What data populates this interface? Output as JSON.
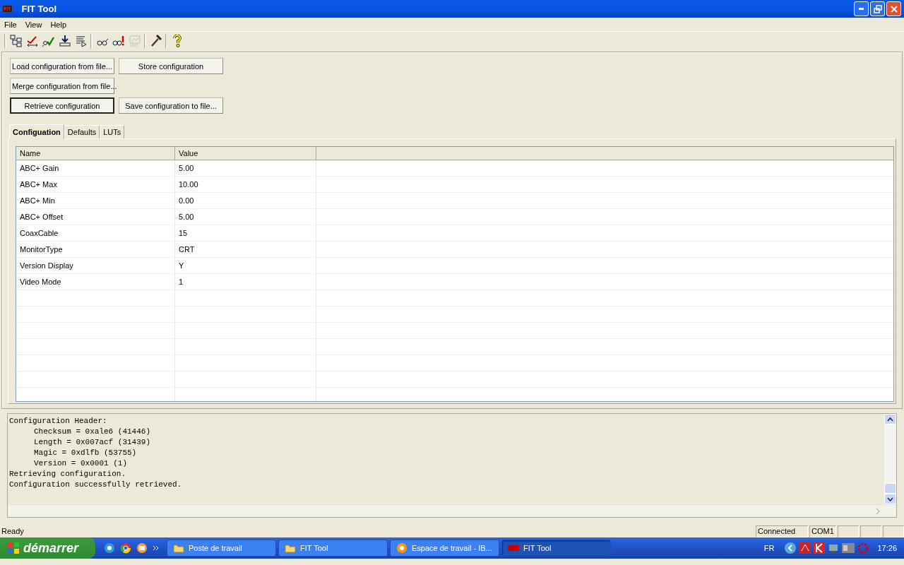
{
  "window": {
    "logo": "FIT",
    "title": "FIT Tool"
  },
  "menu": [
    "File",
    "View",
    "Help"
  ],
  "toolbar": [
    [
      {
        "kind": "tree",
        "disabled": false
      },
      {
        "kind": "crosscheck",
        "disabled": false
      },
      {
        "kind": "searchcheck",
        "disabled": false
      },
      {
        "kind": "download",
        "disabled": false
      },
      {
        "kind": "list",
        "disabled": false
      }
    ],
    [
      {
        "kind": "glasses",
        "disabled": false
      },
      {
        "kind": "glassalert",
        "disabled": false
      },
      {
        "kind": "chart",
        "disabled": true
      }
    ],
    [
      {
        "kind": "hammer",
        "disabled": false
      }
    ],
    [
      {
        "kind": "help",
        "disabled": false
      }
    ]
  ],
  "buttons": [
    [
      {
        "label": "Load configuration from file...",
        "focused": false
      },
      {
        "label": "Store configuration",
        "focused": false
      }
    ],
    [
      {
        "label": "Merge configuration from file...",
        "focused": false
      }
    ],
    [
      {
        "label": "Retrieve configuration",
        "focused": true
      },
      {
        "label": "Save configuration to file...",
        "focused": false
      }
    ]
  ],
  "tabs": [
    {
      "label": "Configuation",
      "selected": true
    },
    {
      "label": "Defaults",
      "selected": false
    },
    {
      "label": "LUTs",
      "selected": false
    }
  ],
  "table": {
    "columns": [
      "Name",
      "Value"
    ],
    "rows": [
      [
        "ABC+ Gain",
        "5.00"
      ],
      [
        "ABC+ Max",
        "10.00"
      ],
      [
        "ABC+ Min",
        "0.00"
      ],
      [
        "ABC+ Offset",
        "5.00"
      ],
      [
        "CoaxCable",
        "15"
      ],
      [
        "MonitorType",
        "CRT"
      ],
      [
        "Version Display",
        "Y"
      ],
      [
        "Video Mode",
        "1"
      ]
    ]
  },
  "log": [
    {
      "text": "Configuration Header:",
      "children": [
        {
          "text": "Checksum = 0xale6 (41446)"
        },
        {
          "text": "Length = 0x007acf (31439)"
        },
        {
          "text": "Magic = 0xdlfb (53755)"
        },
        {
          "text": "Version = 0x0001 (1)"
        }
      ]
    },
    {
      "text": "Retrieving configuration."
    },
    {
      "text": "Configuration successfully retrieved."
    }
  ],
  "status_bar": {
    "message": "Ready",
    "panes": [
      "Connected",
      "COM1"
    ]
  },
  "taskbar": {
    "start": "démarrer",
    "tasks": [
      {
        "label": "Poste de travail",
        "kind": "folder",
        "selected": false
      },
      {
        "label": "FIT Tool",
        "kind": "folder",
        "selected": false
      },
      {
        "label": "Espace de travail - IB...",
        "kind": "app",
        "selected": false
      },
      {
        "label": "FIT Tool",
        "kind": "fit",
        "selected": true
      }
    ],
    "language": "FR",
    "clock": "17:26"
  }
}
